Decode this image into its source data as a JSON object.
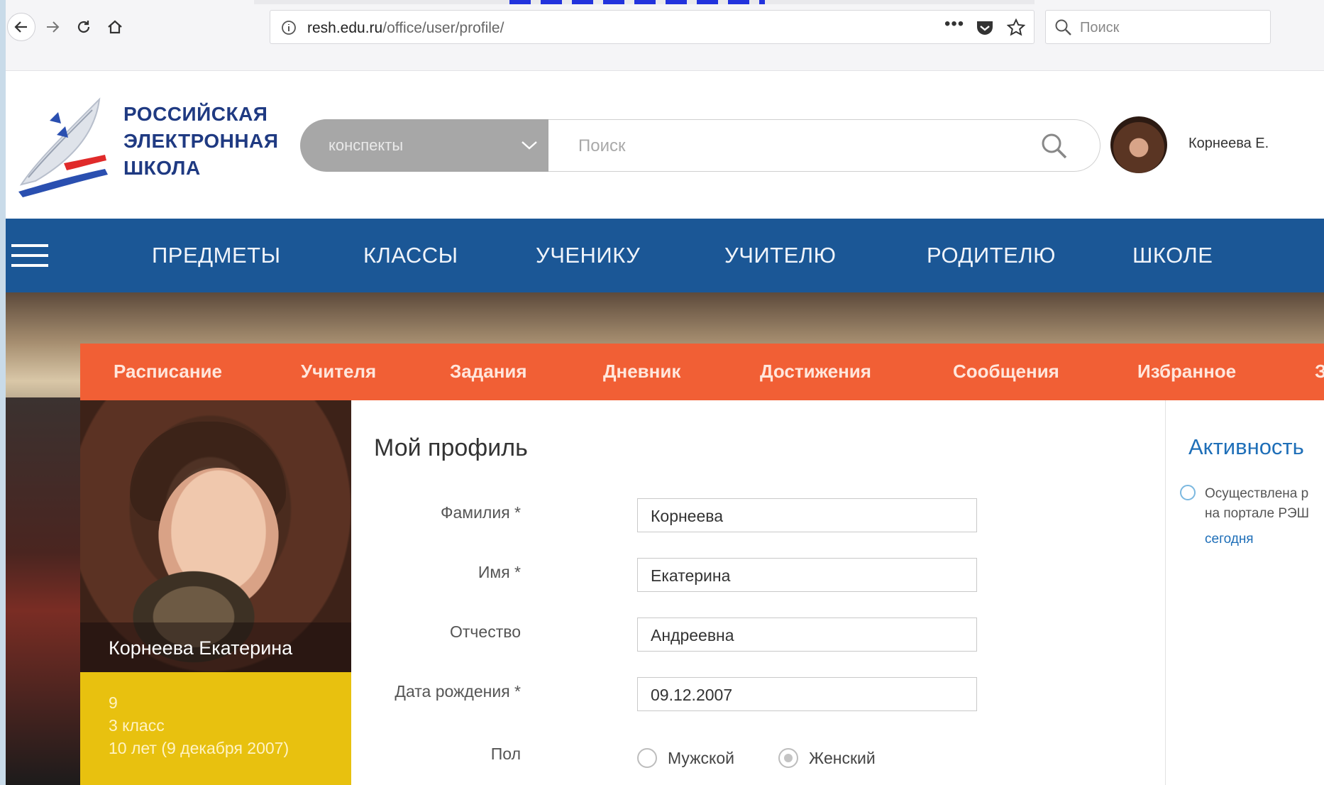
{
  "browser": {
    "url_domain": "resh.edu.ru",
    "url_path": "/office/user/profile/",
    "search_placeholder": "Поиск",
    "menu_dots": "•••"
  },
  "header": {
    "logo_line1": "РОССИЙСКАЯ",
    "logo_line2": "ЭЛЕКТРОННАЯ",
    "logo_line3": "ШКОЛА",
    "category_select": "конспекты",
    "search_placeholder": "Поиск",
    "user_name": "Корнеева Е."
  },
  "main_nav": {
    "items": [
      "ПРЕДМЕТЫ",
      "КЛАССЫ",
      "УЧЕНИКУ",
      "УЧИТЕЛЮ",
      "РОДИТЕЛЮ",
      "ШКОЛЕ"
    ]
  },
  "tabs": {
    "items": [
      "Расписание",
      "Учителя",
      "Задания",
      "Дневник",
      "Достижения",
      "Сообщения",
      "Избранное",
      "З"
    ]
  },
  "profile_card": {
    "full_name": "Корнеева Екатерина",
    "line1": "9",
    "line2": "3 класс",
    "line3": "10 лет (9 декабря 2007)"
  },
  "form": {
    "title": "Мой профиль",
    "last_name_label": "Фамилия *",
    "last_name_value": "Корнеева",
    "first_name_label": "Имя *",
    "first_name_value": "Екатерина",
    "patronymic_label": "Отчество",
    "patronymic_value": "Андреевна",
    "birth_label": "Дата рождения *",
    "birth_value": "09.12.2007",
    "gender_label": "Пол",
    "gender_male": "Мужской",
    "gender_female": "Женский",
    "gender_selected": "Женский"
  },
  "activity": {
    "title": "Активность",
    "item_line1": "Осуществлена р",
    "item_line2": "на портале РЭШ",
    "item_time": "сегодня"
  },
  "colors": {
    "nav_blue": "#1b5796",
    "tab_orange": "#f15f35",
    "card_yellow": "#e8c10f",
    "logo_blue": "#1f3a82",
    "link_blue": "#1f6fb8"
  }
}
